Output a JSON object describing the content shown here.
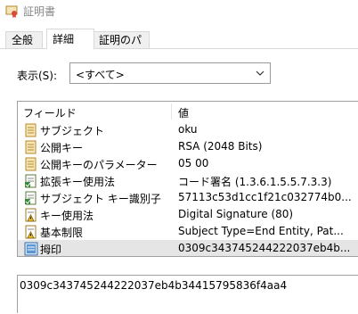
{
  "window": {
    "title": "証明書",
    "icon": "certificate-icon"
  },
  "tabs": [
    {
      "label": "全般",
      "active": false
    },
    {
      "label": "詳細",
      "active": true
    },
    {
      "label": "証明のパス",
      "active": false
    }
  ],
  "show": {
    "label": "表示(S):",
    "selected": "<すべて>"
  },
  "list": {
    "columns": {
      "field": "フィールド",
      "value": "値"
    },
    "rows": [
      {
        "icon": "field-doc-icon",
        "field": "サブジェクト",
        "value": "oku"
      },
      {
        "icon": "field-doc-icon",
        "field": "公開キー",
        "value": "RSA (2048 Bits)"
      },
      {
        "icon": "field-doc-icon",
        "field": "公開キーのパラメーター",
        "value": "05 00"
      },
      {
        "icon": "extension-icon",
        "field": "拡張キー使用法",
        "value": "コード署名 (1.3.6.1.5.5.7.3.3)"
      },
      {
        "icon": "extension-icon",
        "field": "サブジェクト キー識別子",
        "value": "57113c53d1cc1f21c032774b0..."
      },
      {
        "icon": "critical-extension-icon",
        "field": "キー使用法",
        "value": "Digital Signature (80)"
      },
      {
        "icon": "critical-extension-icon",
        "field": "基本制限",
        "value": "Subject Type=End Entity, Pat..."
      },
      {
        "icon": "thumbprint-icon",
        "field": "拇印",
        "value": "0309c343745244222037eb4b...",
        "selected": true
      }
    ]
  },
  "detail": {
    "text": "0309c343745244222037eb4b34415795836f4aa4"
  }
}
